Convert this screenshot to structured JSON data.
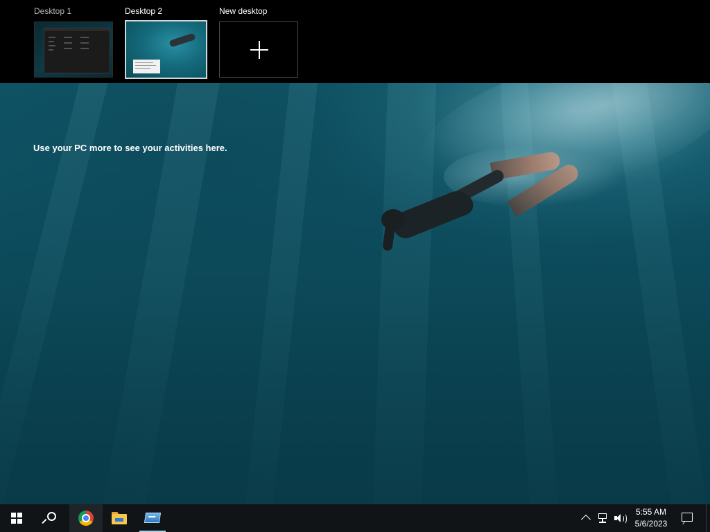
{
  "virtual_desktops": [
    {
      "label": "Desktop 1",
      "active": false
    },
    {
      "label": "Desktop 2",
      "active": true
    },
    {
      "label": "New desktop",
      "icon": "plus-icon"
    }
  ],
  "timeline": {
    "message": "Use your PC more to see your activities here."
  },
  "taskbar": {
    "pinned": [
      {
        "name": "start",
        "icon": "windows-logo-icon"
      },
      {
        "name": "search",
        "icon": "search-icon"
      },
      {
        "name": "Google Chrome",
        "icon": "chrome-icon",
        "running": true
      },
      {
        "name": "File Explorer",
        "icon": "folder-icon"
      },
      {
        "name": "Task View app",
        "icon": "window-app-icon",
        "running": true
      }
    ],
    "tray": {
      "icons": [
        "chevron-up-icon",
        "network-icon",
        "volume-icon"
      ],
      "time": "5:55 AM",
      "date": "5/6/2023"
    }
  },
  "colors": {
    "accent_underline": "#9fd7f0",
    "taskbar_bg": "#101417",
    "strip_bg": "#000000"
  }
}
